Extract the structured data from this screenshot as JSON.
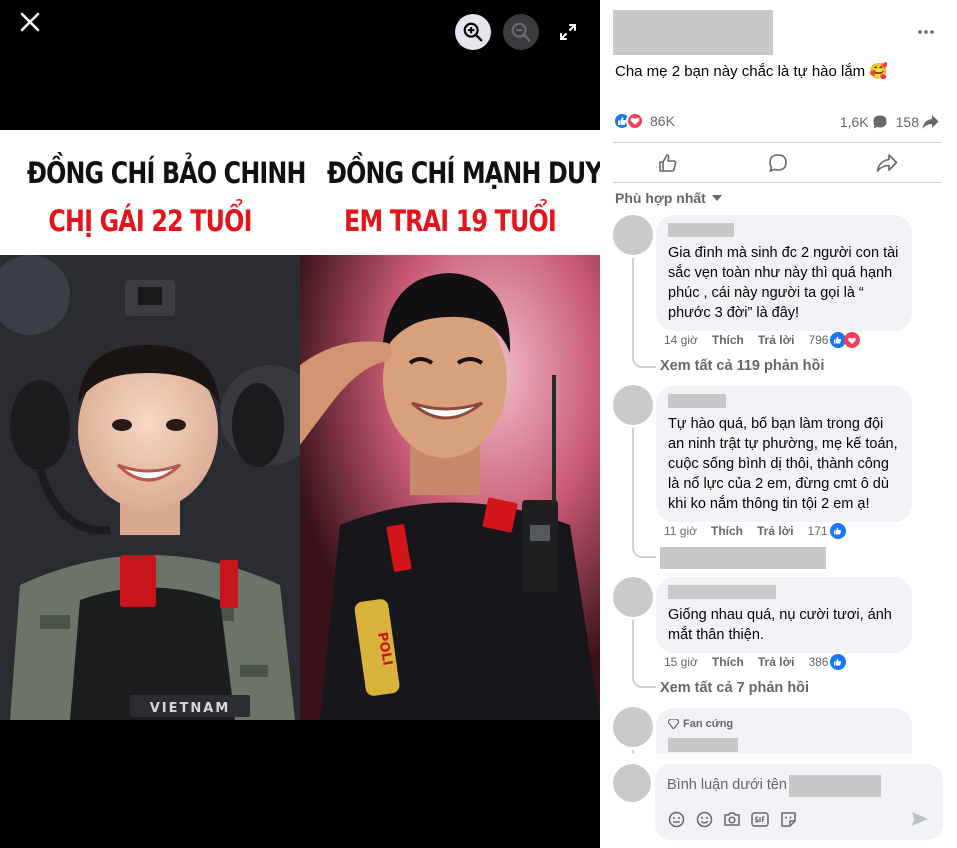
{
  "photo": {
    "left_name": "ĐỒNG CHÍ BẢO CHINH",
    "left_age": "CHỊ GÁI 22 TUỔI",
    "right_name": "ĐỒNG CHÍ MẠNH DUY",
    "right_age": "EM TRAI 19 TUỔI",
    "vest_text": "VIETNAM",
    "badge_text": "POLI"
  },
  "post": {
    "text": "Cha mẹ 2 bạn này chắc là tự hào lắm 🥰",
    "reaction_count": "86K",
    "comment_count": "1,6K",
    "share_count": "158"
  },
  "sort_label": "Phù hợp nhất",
  "comments": [
    {
      "text": "Gia đình mà sinh đc 2 người con tài sắc vẹn toàn như này thì quá hạnh phúc , cái này người ta gọi là “ phước 3 đời” là đây!",
      "time": "14 giờ",
      "like": "Thích",
      "reply": "Trả lời",
      "reactions": "796",
      "replies": "Xem tất cả 119 phản hồi"
    },
    {
      "text": "Tự hào quá, bố bạn làm trong đội an ninh trật tự phường, mẹ kế toán, cuộc sống bình dị thôi, thành công là nổ lực của 2 em, đừng cmt ô dù khi ko nắm thông tin tội 2 em ạ!",
      "time": "11 giờ",
      "like": "Thích",
      "reply": "Trả lời",
      "reactions": "171"
    },
    {
      "text": "Giống nhau quá, nụ cười tươi, ánh mắt thân thiện.",
      "time": "15 giờ",
      "like": "Thích",
      "reply": "Trả lời",
      "reactions": "386",
      "replies": "Xem tất cả 7 phản hồi"
    },
    {
      "badge": "Fan cứng"
    }
  ],
  "composer": {
    "placeholder": "Bình luận dưới tên"
  },
  "colors": {
    "like_blue": "#1877f2",
    "love_red": "#f33e58",
    "headline_red": "#e3141b"
  }
}
